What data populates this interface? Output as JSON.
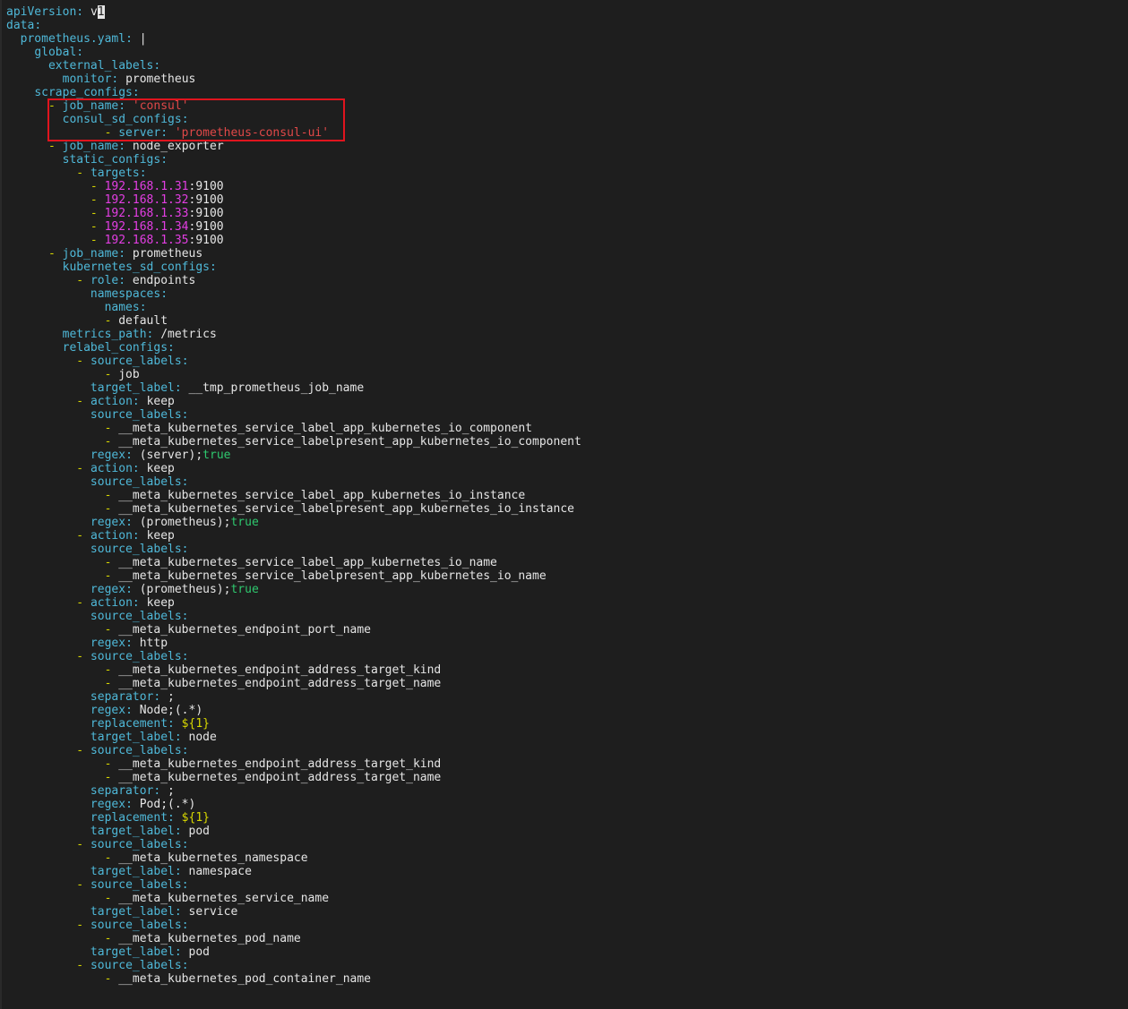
{
  "editor": {
    "colors": {
      "background": "#1e1e1e",
      "key": "#4fb8d8",
      "dash": "#d7d700",
      "value": "#e5e5e5",
      "string": "#e04848",
      "number": "#e33ee3",
      "boolean": "#2ec86e",
      "template": "#d7d700",
      "highlight_box": "#e0141e"
    },
    "highlight": {
      "from_line": 8,
      "to_line": 10
    },
    "lines": [
      [
        [
          "k",
          "apiVersion"
        ],
        [
          "p",
          ": "
        ],
        [
          "v",
          "v"
        ],
        [
          "c",
          "1"
        ]
      ],
      [
        [
          "k",
          "data"
        ],
        [
          "p",
          ":"
        ]
      ],
      [
        [
          "v",
          "  "
        ],
        [
          "k",
          "prometheus.yaml"
        ],
        [
          "p",
          ": "
        ],
        [
          "v",
          "|"
        ]
      ],
      [
        [
          "v",
          "    "
        ],
        [
          "k",
          "global"
        ],
        [
          "p",
          ":"
        ]
      ],
      [
        [
          "v",
          "      "
        ],
        [
          "k",
          "external_labels"
        ],
        [
          "p",
          ":"
        ]
      ],
      [
        [
          "v",
          "        "
        ],
        [
          "k",
          "monitor"
        ],
        [
          "p",
          ": "
        ],
        [
          "v",
          "prometheus"
        ]
      ],
      [
        [
          "v",
          "    "
        ],
        [
          "k",
          "scrape_configs"
        ],
        [
          "p",
          ":"
        ]
      ],
      [
        [
          "v",
          "      "
        ],
        [
          "d",
          "- "
        ],
        [
          "k",
          "job_name"
        ],
        [
          "p",
          ": "
        ],
        [
          "s",
          "'consul'"
        ]
      ],
      [
        [
          "v",
          "        "
        ],
        [
          "k",
          "consul_sd_configs"
        ],
        [
          "p",
          ":"
        ]
      ],
      [
        [
          "v",
          "              "
        ],
        [
          "d",
          "- "
        ],
        [
          "k",
          "server"
        ],
        [
          "p",
          ": "
        ],
        [
          "s",
          "'prometheus-consul-ui'"
        ]
      ],
      [
        [
          "v",
          "      "
        ],
        [
          "d",
          "- "
        ],
        [
          "k",
          "job_name"
        ],
        [
          "p",
          ": "
        ],
        [
          "v",
          "node_exporter"
        ]
      ],
      [
        [
          "v",
          "        "
        ],
        [
          "k",
          "static_configs"
        ],
        [
          "p",
          ":"
        ]
      ],
      [
        [
          "v",
          "          "
        ],
        [
          "d",
          "- "
        ],
        [
          "k",
          "targets"
        ],
        [
          "p",
          ":"
        ]
      ],
      [
        [
          "v",
          "            "
        ],
        [
          "d",
          "- "
        ],
        [
          "n",
          "192.168.1.31"
        ],
        [
          "v",
          ":9100"
        ]
      ],
      [
        [
          "v",
          "            "
        ],
        [
          "d",
          "- "
        ],
        [
          "n",
          "192.168.1.32"
        ],
        [
          "v",
          ":9100"
        ]
      ],
      [
        [
          "v",
          "            "
        ],
        [
          "d",
          "- "
        ],
        [
          "n",
          "192.168.1.33"
        ],
        [
          "v",
          ":9100"
        ]
      ],
      [
        [
          "v",
          "            "
        ],
        [
          "d",
          "- "
        ],
        [
          "n",
          "192.168.1.34"
        ],
        [
          "v",
          ":9100"
        ]
      ],
      [
        [
          "v",
          "            "
        ],
        [
          "d",
          "- "
        ],
        [
          "n",
          "192.168.1.35"
        ],
        [
          "v",
          ":9100"
        ]
      ],
      [
        [
          "v",
          "      "
        ],
        [
          "d",
          "- "
        ],
        [
          "k",
          "job_name"
        ],
        [
          "p",
          ": "
        ],
        [
          "v",
          "prometheus"
        ]
      ],
      [
        [
          "v",
          "        "
        ],
        [
          "k",
          "kubernetes_sd_configs"
        ],
        [
          "p",
          ":"
        ]
      ],
      [
        [
          "v",
          "          "
        ],
        [
          "d",
          "- "
        ],
        [
          "k",
          "role"
        ],
        [
          "p",
          ": "
        ],
        [
          "v",
          "endpoints"
        ]
      ],
      [
        [
          "v",
          "            "
        ],
        [
          "k",
          "namespaces"
        ],
        [
          "p",
          ":"
        ]
      ],
      [
        [
          "v",
          "              "
        ],
        [
          "k",
          "names"
        ],
        [
          "p",
          ":"
        ]
      ],
      [
        [
          "v",
          "              "
        ],
        [
          "d",
          "- "
        ],
        [
          "v",
          "default"
        ]
      ],
      [
        [
          "v",
          "        "
        ],
        [
          "k",
          "metrics_path"
        ],
        [
          "p",
          ": "
        ],
        [
          "v",
          "/metrics"
        ]
      ],
      [
        [
          "v",
          "        "
        ],
        [
          "k",
          "relabel_configs"
        ],
        [
          "p",
          ":"
        ]
      ],
      [
        [
          "v",
          "          "
        ],
        [
          "d",
          "- "
        ],
        [
          "k",
          "source_labels"
        ],
        [
          "p",
          ":"
        ]
      ],
      [
        [
          "v",
          "              "
        ],
        [
          "d",
          "- "
        ],
        [
          "v",
          "job"
        ]
      ],
      [
        [
          "v",
          "            "
        ],
        [
          "k",
          "target_label"
        ],
        [
          "p",
          ": "
        ],
        [
          "v",
          "__tmp_prometheus_job_name"
        ]
      ],
      [
        [
          "v",
          "          "
        ],
        [
          "d",
          "- "
        ],
        [
          "k",
          "action"
        ],
        [
          "p",
          ": "
        ],
        [
          "v",
          "keep"
        ]
      ],
      [
        [
          "v",
          "            "
        ],
        [
          "k",
          "source_labels"
        ],
        [
          "p",
          ":"
        ]
      ],
      [
        [
          "v",
          "              "
        ],
        [
          "d",
          "- "
        ],
        [
          "v",
          "__meta_kubernetes_service_label_app_kubernetes_io_component"
        ]
      ],
      [
        [
          "v",
          "              "
        ],
        [
          "d",
          "- "
        ],
        [
          "v",
          "__meta_kubernetes_service_labelpresent_app_kubernetes_io_component"
        ]
      ],
      [
        [
          "v",
          "            "
        ],
        [
          "k",
          "regex"
        ],
        [
          "p",
          ": "
        ],
        [
          "v",
          "(server);"
        ],
        [
          "b",
          "true"
        ]
      ],
      [
        [
          "v",
          "          "
        ],
        [
          "d",
          "- "
        ],
        [
          "k",
          "action"
        ],
        [
          "p",
          ": "
        ],
        [
          "v",
          "keep"
        ]
      ],
      [
        [
          "v",
          "            "
        ],
        [
          "k",
          "source_labels"
        ],
        [
          "p",
          ":"
        ]
      ],
      [
        [
          "v",
          "              "
        ],
        [
          "d",
          "- "
        ],
        [
          "v",
          "__meta_kubernetes_service_label_app_kubernetes_io_instance"
        ]
      ],
      [
        [
          "v",
          "              "
        ],
        [
          "d",
          "- "
        ],
        [
          "v",
          "__meta_kubernetes_service_labelpresent_app_kubernetes_io_instance"
        ]
      ],
      [
        [
          "v",
          "            "
        ],
        [
          "k",
          "regex"
        ],
        [
          "p",
          ": "
        ],
        [
          "v",
          "(prometheus);"
        ],
        [
          "b",
          "true"
        ]
      ],
      [
        [
          "v",
          "          "
        ],
        [
          "d",
          "- "
        ],
        [
          "k",
          "action"
        ],
        [
          "p",
          ": "
        ],
        [
          "v",
          "keep"
        ]
      ],
      [
        [
          "v",
          "            "
        ],
        [
          "k",
          "source_labels"
        ],
        [
          "p",
          ":"
        ]
      ],
      [
        [
          "v",
          "              "
        ],
        [
          "d",
          "- "
        ],
        [
          "v",
          "__meta_kubernetes_service_label_app_kubernetes_io_name"
        ]
      ],
      [
        [
          "v",
          "              "
        ],
        [
          "d",
          "- "
        ],
        [
          "v",
          "__meta_kubernetes_service_labelpresent_app_kubernetes_io_name"
        ]
      ],
      [
        [
          "v",
          "            "
        ],
        [
          "k",
          "regex"
        ],
        [
          "p",
          ": "
        ],
        [
          "v",
          "(prometheus);"
        ],
        [
          "b",
          "true"
        ]
      ],
      [
        [
          "v",
          "          "
        ],
        [
          "d",
          "- "
        ],
        [
          "k",
          "action"
        ],
        [
          "p",
          ": "
        ],
        [
          "v",
          "keep"
        ]
      ],
      [
        [
          "v",
          "            "
        ],
        [
          "k",
          "source_labels"
        ],
        [
          "p",
          ":"
        ]
      ],
      [
        [
          "v",
          "              "
        ],
        [
          "d",
          "- "
        ],
        [
          "v",
          "__meta_kubernetes_endpoint_port_name"
        ]
      ],
      [
        [
          "v",
          "            "
        ],
        [
          "k",
          "regex"
        ],
        [
          "p",
          ": "
        ],
        [
          "v",
          "http"
        ]
      ],
      [
        [
          "v",
          "          "
        ],
        [
          "d",
          "- "
        ],
        [
          "k",
          "source_labels"
        ],
        [
          "p",
          ":"
        ]
      ],
      [
        [
          "v",
          "              "
        ],
        [
          "d",
          "- "
        ],
        [
          "v",
          "__meta_kubernetes_endpoint_address_target_kind"
        ]
      ],
      [
        [
          "v",
          "              "
        ],
        [
          "d",
          "- "
        ],
        [
          "v",
          "__meta_kubernetes_endpoint_address_target_name"
        ]
      ],
      [
        [
          "v",
          "            "
        ],
        [
          "k",
          "separator"
        ],
        [
          "p",
          ": "
        ],
        [
          "v",
          ";"
        ]
      ],
      [
        [
          "v",
          "            "
        ],
        [
          "k",
          "regex"
        ],
        [
          "p",
          ": "
        ],
        [
          "v",
          "Node;(.*)"
        ]
      ],
      [
        [
          "v",
          "            "
        ],
        [
          "k",
          "replacement"
        ],
        [
          "p",
          ": "
        ],
        [
          "y",
          "${1}"
        ]
      ],
      [
        [
          "v",
          "            "
        ],
        [
          "k",
          "target_label"
        ],
        [
          "p",
          ": "
        ],
        [
          "v",
          "node"
        ]
      ],
      [
        [
          "v",
          "          "
        ],
        [
          "d",
          "- "
        ],
        [
          "k",
          "source_labels"
        ],
        [
          "p",
          ":"
        ]
      ],
      [
        [
          "v",
          "              "
        ],
        [
          "d",
          "- "
        ],
        [
          "v",
          "__meta_kubernetes_endpoint_address_target_kind"
        ]
      ],
      [
        [
          "v",
          "              "
        ],
        [
          "d",
          "- "
        ],
        [
          "v",
          "__meta_kubernetes_endpoint_address_target_name"
        ]
      ],
      [
        [
          "v",
          "            "
        ],
        [
          "k",
          "separator"
        ],
        [
          "p",
          ": "
        ],
        [
          "v",
          ";"
        ]
      ],
      [
        [
          "v",
          "            "
        ],
        [
          "k",
          "regex"
        ],
        [
          "p",
          ": "
        ],
        [
          "v",
          "Pod;(.*)"
        ]
      ],
      [
        [
          "v",
          "            "
        ],
        [
          "k",
          "replacement"
        ],
        [
          "p",
          ": "
        ],
        [
          "y",
          "${1}"
        ]
      ],
      [
        [
          "v",
          "            "
        ],
        [
          "k",
          "target_label"
        ],
        [
          "p",
          ": "
        ],
        [
          "v",
          "pod"
        ]
      ],
      [
        [
          "v",
          "          "
        ],
        [
          "d",
          "- "
        ],
        [
          "k",
          "source_labels"
        ],
        [
          "p",
          ":"
        ]
      ],
      [
        [
          "v",
          "              "
        ],
        [
          "d",
          "- "
        ],
        [
          "v",
          "__meta_kubernetes_namespace"
        ]
      ],
      [
        [
          "v",
          "            "
        ],
        [
          "k",
          "target_label"
        ],
        [
          "p",
          ": "
        ],
        [
          "v",
          "namespace"
        ]
      ],
      [
        [
          "v",
          "          "
        ],
        [
          "d",
          "- "
        ],
        [
          "k",
          "source_labels"
        ],
        [
          "p",
          ":"
        ]
      ],
      [
        [
          "v",
          "              "
        ],
        [
          "d",
          "- "
        ],
        [
          "v",
          "__meta_kubernetes_service_name"
        ]
      ],
      [
        [
          "v",
          "            "
        ],
        [
          "k",
          "target_label"
        ],
        [
          "p",
          ": "
        ],
        [
          "v",
          "service"
        ]
      ],
      [
        [
          "v",
          "          "
        ],
        [
          "d",
          "- "
        ],
        [
          "k",
          "source_labels"
        ],
        [
          "p",
          ":"
        ]
      ],
      [
        [
          "v",
          "              "
        ],
        [
          "d",
          "- "
        ],
        [
          "v",
          "__meta_kubernetes_pod_name"
        ]
      ],
      [
        [
          "v",
          "            "
        ],
        [
          "k",
          "target_label"
        ],
        [
          "p",
          ": "
        ],
        [
          "v",
          "pod"
        ]
      ],
      [
        [
          "v",
          "          "
        ],
        [
          "d",
          "- "
        ],
        [
          "k",
          "source_labels"
        ],
        [
          "p",
          ":"
        ]
      ],
      [
        [
          "v",
          "              "
        ],
        [
          "d",
          "- "
        ],
        [
          "v",
          "__meta_kubernetes_pod_container_name"
        ]
      ]
    ]
  }
}
